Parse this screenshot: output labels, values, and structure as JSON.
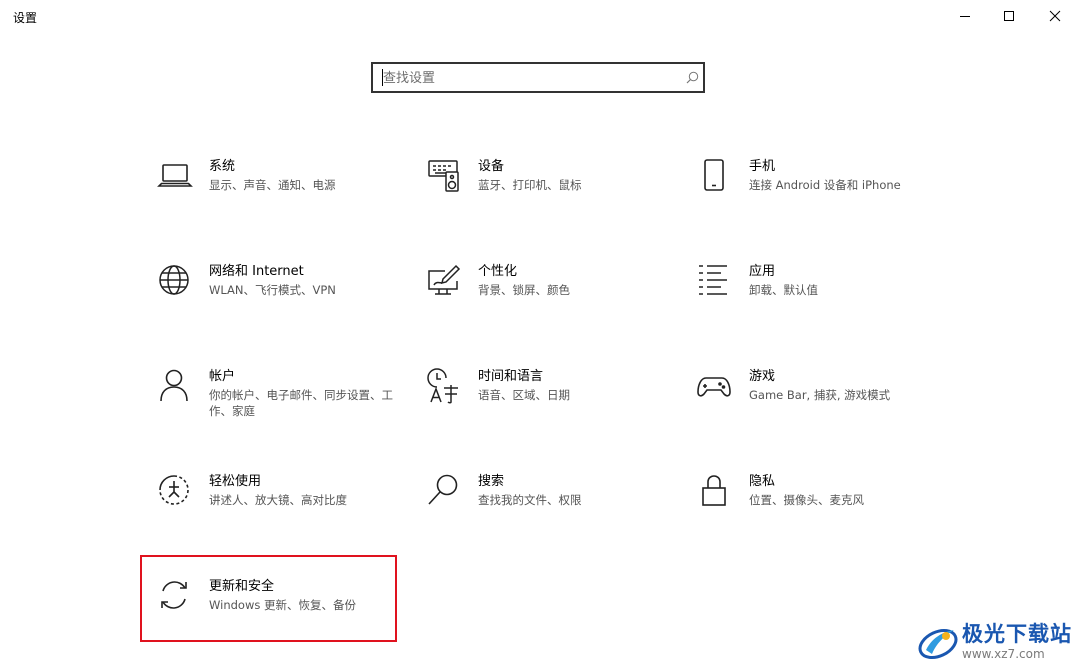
{
  "window": {
    "title": "设置"
  },
  "search": {
    "placeholder": "查找设置",
    "value": ""
  },
  "tiles": [
    {
      "title": "系统",
      "desc": "显示、声音、通知、电源",
      "icon": "laptop-icon"
    },
    {
      "title": "设备",
      "desc": "蓝牙、打印机、鼠标",
      "icon": "devices-icon"
    },
    {
      "title": "手机",
      "desc": "连接 Android 设备和 iPhone",
      "icon": "phone-icon"
    },
    {
      "title": "网络和 Internet",
      "desc": "WLAN、飞行模式、VPN",
      "icon": "globe-icon"
    },
    {
      "title": "个性化",
      "desc": "背景、锁屏、颜色",
      "icon": "personalization-icon"
    },
    {
      "title": "应用",
      "desc": "卸载、默认值",
      "icon": "apps-list-icon"
    },
    {
      "title": "帐户",
      "desc": "你的帐户、电子邮件、同步设置、工作、家庭",
      "icon": "person-icon"
    },
    {
      "title": "时间和语言",
      "desc": "语音、区域、日期",
      "icon": "time-language-icon"
    },
    {
      "title": "游戏",
      "desc": "Game Bar, 捕获, 游戏模式",
      "icon": "gamepad-icon"
    },
    {
      "title": "轻松使用",
      "desc": "讲述人、放大镜、高对比度",
      "icon": "ease-of-access-icon"
    },
    {
      "title": "搜索",
      "desc": "查找我的文件、权限",
      "icon": "search-icon"
    },
    {
      "title": "隐私",
      "desc": "位置、摄像头、麦克风",
      "icon": "lock-icon"
    },
    {
      "title": "更新和安全",
      "desc": "Windows 更新、恢复、备份",
      "icon": "sync-icon"
    }
  ],
  "watermark": {
    "text": "极光下载站",
    "url": "www.xz7.com"
  },
  "colors": {
    "highlight": "#e0121e",
    "watermark": "#1a57b0"
  }
}
